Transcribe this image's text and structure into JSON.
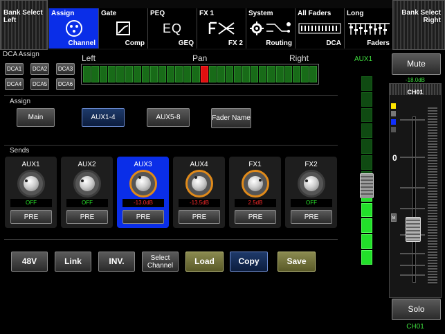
{
  "nav": {
    "bank_left": "Bank Select Left",
    "bank_right": "Bank Select Right",
    "tabs": [
      {
        "top": "Assign",
        "bottom": "Channel",
        "icon": "xlr-connector-icon",
        "active": true
      },
      {
        "top": "Gate",
        "bottom": "Comp",
        "icon": "compressor-curve-icon",
        "active": false
      },
      {
        "top": "PEQ",
        "bottom": "GEQ",
        "icon": "eq-text-icon",
        "icon_text": "EQ",
        "active": false
      },
      {
        "top": "FX 1",
        "bottom": "FX 2",
        "icon": "fx-logo-icon",
        "active": false
      },
      {
        "top": "System",
        "bottom": "Routing",
        "icon": "gear-routing-icon",
        "active": false
      },
      {
        "top": "All Faders",
        "bottom": "DCA",
        "icon": "faders-grid-icon",
        "active": false
      },
      {
        "top": "Long",
        "bottom": "Faders",
        "icon": "long-faders-icon",
        "active": false
      }
    ]
  },
  "dca": {
    "title": "DCA Assign",
    "buttons": [
      "DCA1",
      "DCA2",
      "DCA3",
      "DCA4",
      "DCA5",
      "DCA6"
    ]
  },
  "pan": {
    "left": "Left",
    "center": "Pan",
    "right": "Right",
    "position": 0.5
  },
  "assign": {
    "title": "Assign",
    "buttons": [
      "Main",
      "AUX1-4",
      "AUX5-8",
      "Fader Name"
    ]
  },
  "sends": {
    "title": "Sends",
    "strips": [
      {
        "name": "AUX1",
        "value": "OFF",
        "mode": "PRE"
      },
      {
        "name": "AUX2",
        "value": "OFF",
        "mode": "PRE"
      },
      {
        "name": "AUX3",
        "value": "-13.0dB",
        "mode": "PRE"
      },
      {
        "name": "AUX4",
        "value": "-13.5dB",
        "mode": "PRE"
      },
      {
        "name": "FX1",
        "value": "2.5dB",
        "mode": "PRE"
      },
      {
        "name": "FX2",
        "value": "OFF",
        "mode": "PRE"
      }
    ]
  },
  "bottom": {
    "phantom": "48V",
    "link": "Link",
    "invert": "INV.",
    "select_channel": "Select Channel",
    "load": "Load",
    "copy": "Copy",
    "save": "Save"
  },
  "aux_meter": {
    "label": "AUX1",
    "level": 0.4
  },
  "channel": {
    "mute": "Mute",
    "db": "-18.0dB",
    "name": "CH01",
    "scale_zero": "0",
    "m_label": "M",
    "solo": "Solo",
    "footer_name": "CH01",
    "colors": {
      "accent_blue": "#0a2ee8",
      "meter_green": "#22e02a",
      "pan_red": "#e01010"
    }
  }
}
